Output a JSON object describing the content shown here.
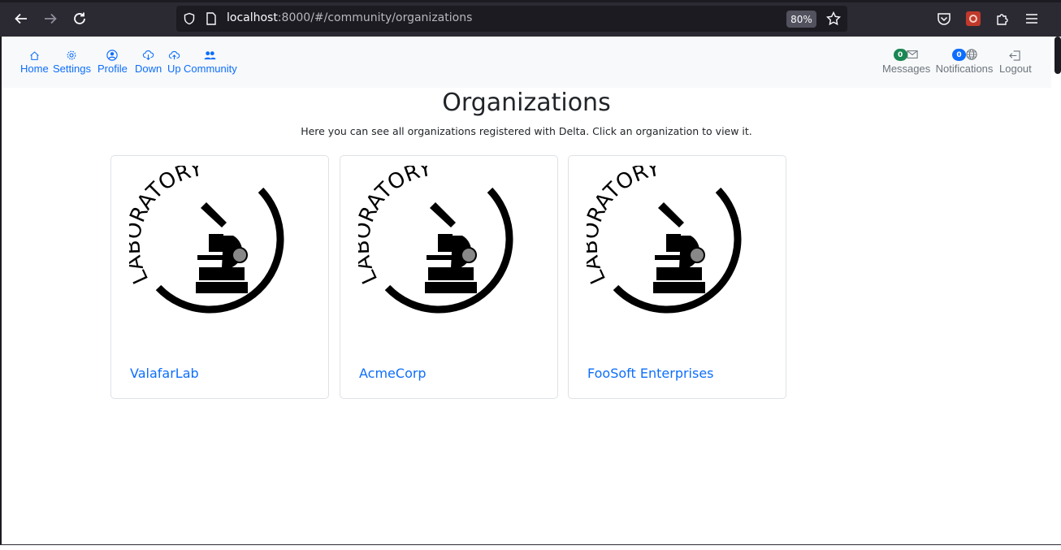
{
  "browser": {
    "url_host": "localhost",
    "url_rest": ":8000/#/community/organizations",
    "zoom": "80%"
  },
  "nav": {
    "left": [
      {
        "label": "Home",
        "icon": "house-icon"
      },
      {
        "label": "Settings",
        "icon": "gear-icon"
      },
      {
        "label": "Profile",
        "icon": "person-circle-icon"
      },
      {
        "label": "Down",
        "icon": "cloud-download-icon"
      },
      {
        "label": "Up",
        "icon": "cloud-upload-icon"
      },
      {
        "label": "Community",
        "icon": "people-icon"
      }
    ],
    "right": [
      {
        "label": "Messages",
        "icon": "envelope-icon",
        "badge": "0",
        "badge_color": "#198754"
      },
      {
        "label": "Notifications",
        "icon": "globe-icon",
        "badge": "0",
        "badge_color": "#0d6efd"
      },
      {
        "label": "Logout",
        "icon": "box-arrow-left-icon"
      }
    ]
  },
  "page": {
    "title": "Organizations",
    "subtitle": "Here you can see all organizations registered with Delta. Click an organization to view it."
  },
  "organizations": [
    {
      "name": "ValafarLab",
      "logo_text": "LABORATORY"
    },
    {
      "name": "AcmeCorp",
      "logo_text": "LABORATORY"
    },
    {
      "name": "FooSoft Enterprises",
      "logo_text": "LABORATORY"
    }
  ],
  "colors": {
    "link": "#0d6efd",
    "nav_bg": "#f8f9fa",
    "browser_bg": "#2b2a33"
  }
}
